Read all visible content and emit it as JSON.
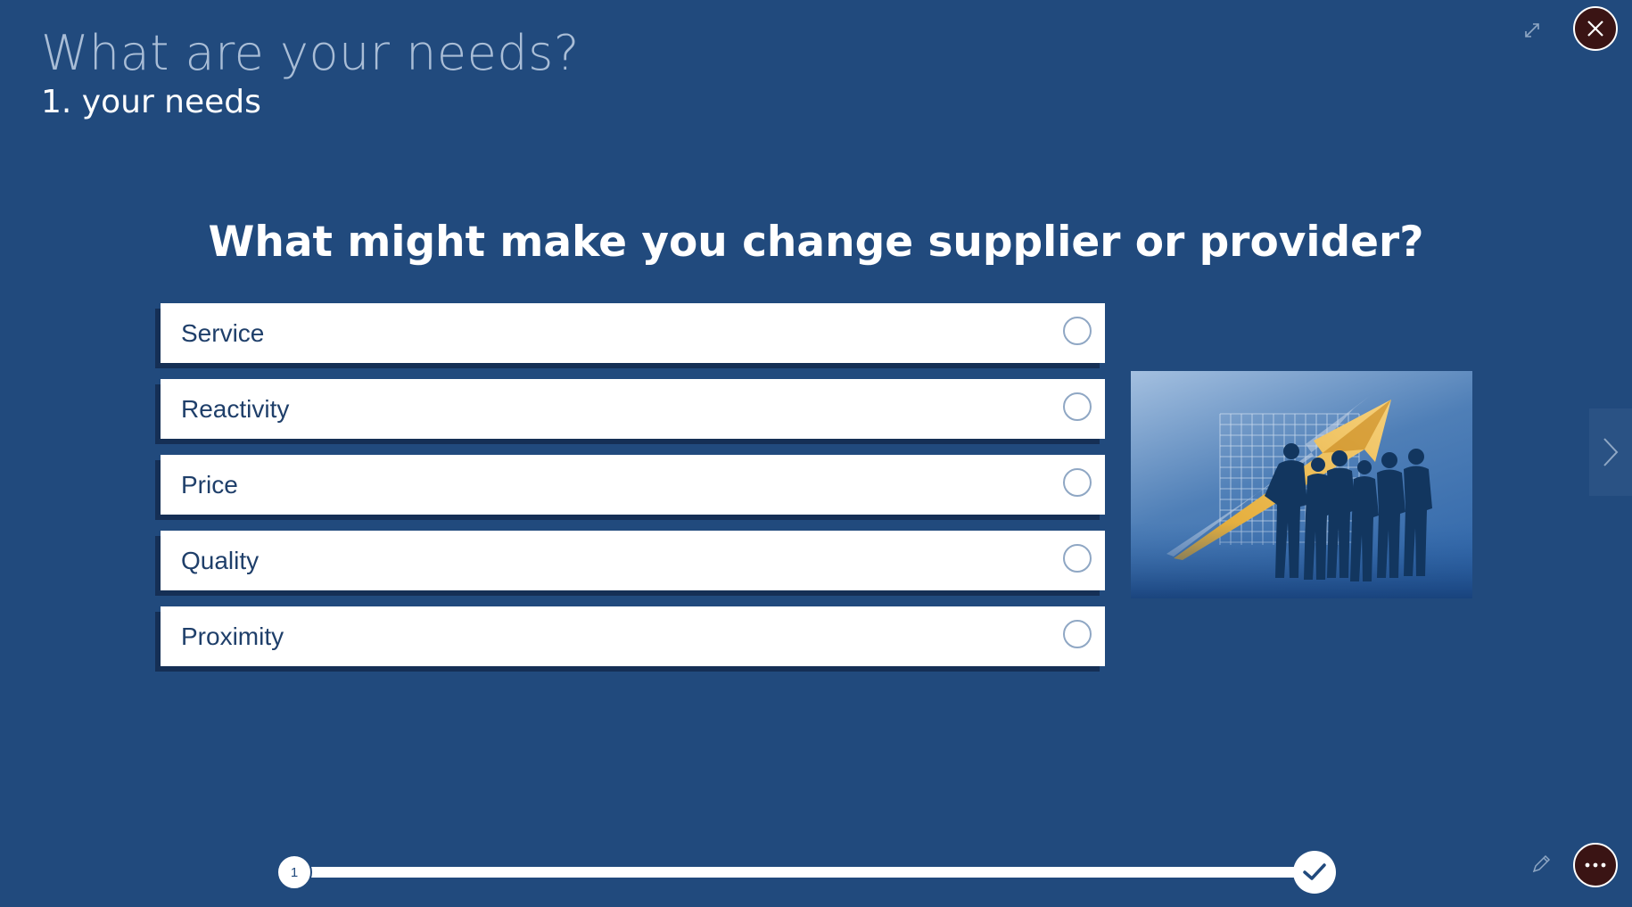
{
  "header": {
    "title": "What are your needs?",
    "subtitle": "1. your needs"
  },
  "question": "What might make you change supplier or provider?",
  "options": [
    {
      "label": "Service",
      "selected": false
    },
    {
      "label": "Reactivity",
      "selected": false
    },
    {
      "label": "Price",
      "selected": false
    },
    {
      "label": "Quality",
      "selected": false
    },
    {
      "label": "Proximity",
      "selected": false
    }
  ],
  "progress": {
    "current_step": "1"
  },
  "icons": {
    "expand": "expand-icon",
    "close": "close-icon",
    "next": "chevron-right-icon",
    "finish": "checkmark-icon",
    "edit": "pencil-icon",
    "more": "ellipsis-icon"
  },
  "colors": {
    "background": "#214a7d",
    "option_text": "#1f3f6a",
    "control_button": "#3a1414"
  }
}
